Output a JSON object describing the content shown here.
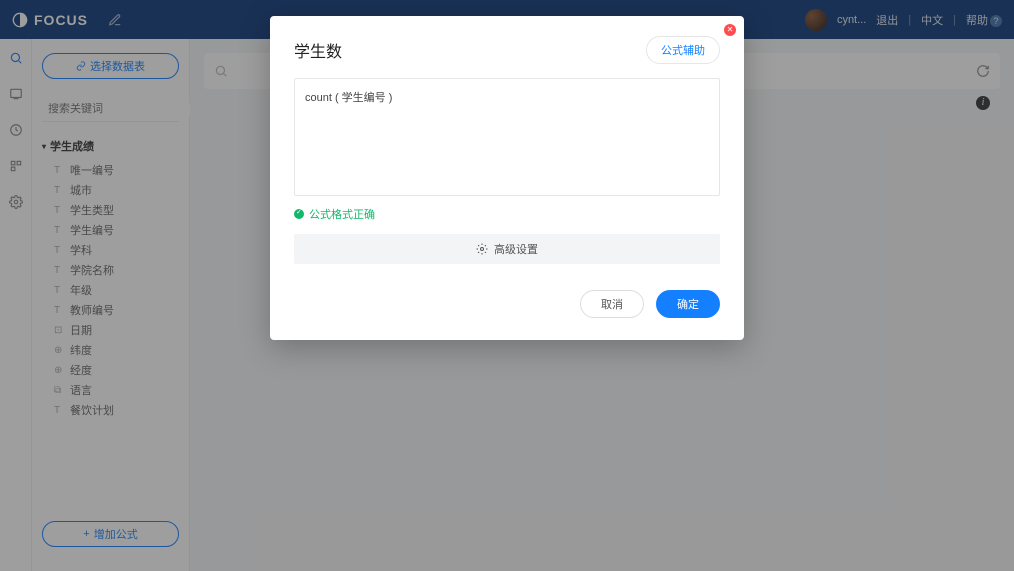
{
  "header": {
    "brand": "FOCUS",
    "user": "cynt...",
    "logout": "退出",
    "lang": "中文",
    "help": "帮助"
  },
  "side": {
    "select_table": "选择数据表",
    "search_placeholder": "搜索关键词",
    "tree_title": "学生成绩",
    "items": [
      {
        "icon": "T",
        "label": "唯一编号"
      },
      {
        "icon": "T",
        "label": "城市"
      },
      {
        "icon": "T",
        "label": "学生类型"
      },
      {
        "icon": "T",
        "label": "学生编号"
      },
      {
        "icon": "T",
        "label": "学科"
      },
      {
        "icon": "T",
        "label": "学院名称"
      },
      {
        "icon": "T",
        "label": "年级"
      },
      {
        "icon": "T",
        "label": "教师编号"
      },
      {
        "icon": "⊡",
        "label": "日期"
      },
      {
        "icon": "⊕",
        "label": "纬度"
      },
      {
        "icon": "⊕",
        "label": "经度"
      },
      {
        "icon": "⧉",
        "label": "语言"
      },
      {
        "icon": "T",
        "label": "餐饮计划"
      }
    ],
    "add_formula": "增加公式"
  },
  "modal": {
    "title": "学生数",
    "helper": "公式辅助",
    "formula": "count ( 学生编号 )",
    "valid_text": "公式格式正确",
    "advanced": "高级设置",
    "cancel": "取消",
    "confirm": "确定"
  }
}
